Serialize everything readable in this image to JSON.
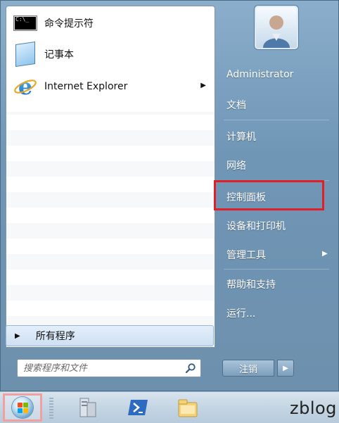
{
  "pinned_programs": [
    {
      "label": "命令提示符",
      "icon": "command-prompt-icon",
      "has_submenu": false
    },
    {
      "label": "记事本",
      "icon": "notepad-icon",
      "has_submenu": false
    },
    {
      "label": "Internet Explorer",
      "icon": "internet-explorer-icon",
      "has_submenu": true
    }
  ],
  "all_programs": {
    "label": "所有程序"
  },
  "search": {
    "placeholder": "搜索程序和文件"
  },
  "user": {
    "name": "Administrator"
  },
  "right_items": [
    {
      "label": "文档",
      "has_submenu": false
    },
    {
      "label": "计算机",
      "has_submenu": false
    },
    {
      "label": "网络",
      "has_submenu": false
    },
    {
      "label": "控制面板",
      "has_submenu": false,
      "highlighted": true
    },
    {
      "label": "设备和打印机",
      "has_submenu": false
    },
    {
      "label": "管理工具",
      "has_submenu": true
    },
    {
      "label": "帮助和支持",
      "has_submenu": false
    },
    {
      "label": "运行...",
      "has_submenu": false
    }
  ],
  "shutdown": {
    "label": "注销"
  },
  "watermark": "zblog",
  "colors": {
    "highlight": "#e02027",
    "menu_bg": "#7096b6",
    "taskbar": "#c4d5e3"
  }
}
